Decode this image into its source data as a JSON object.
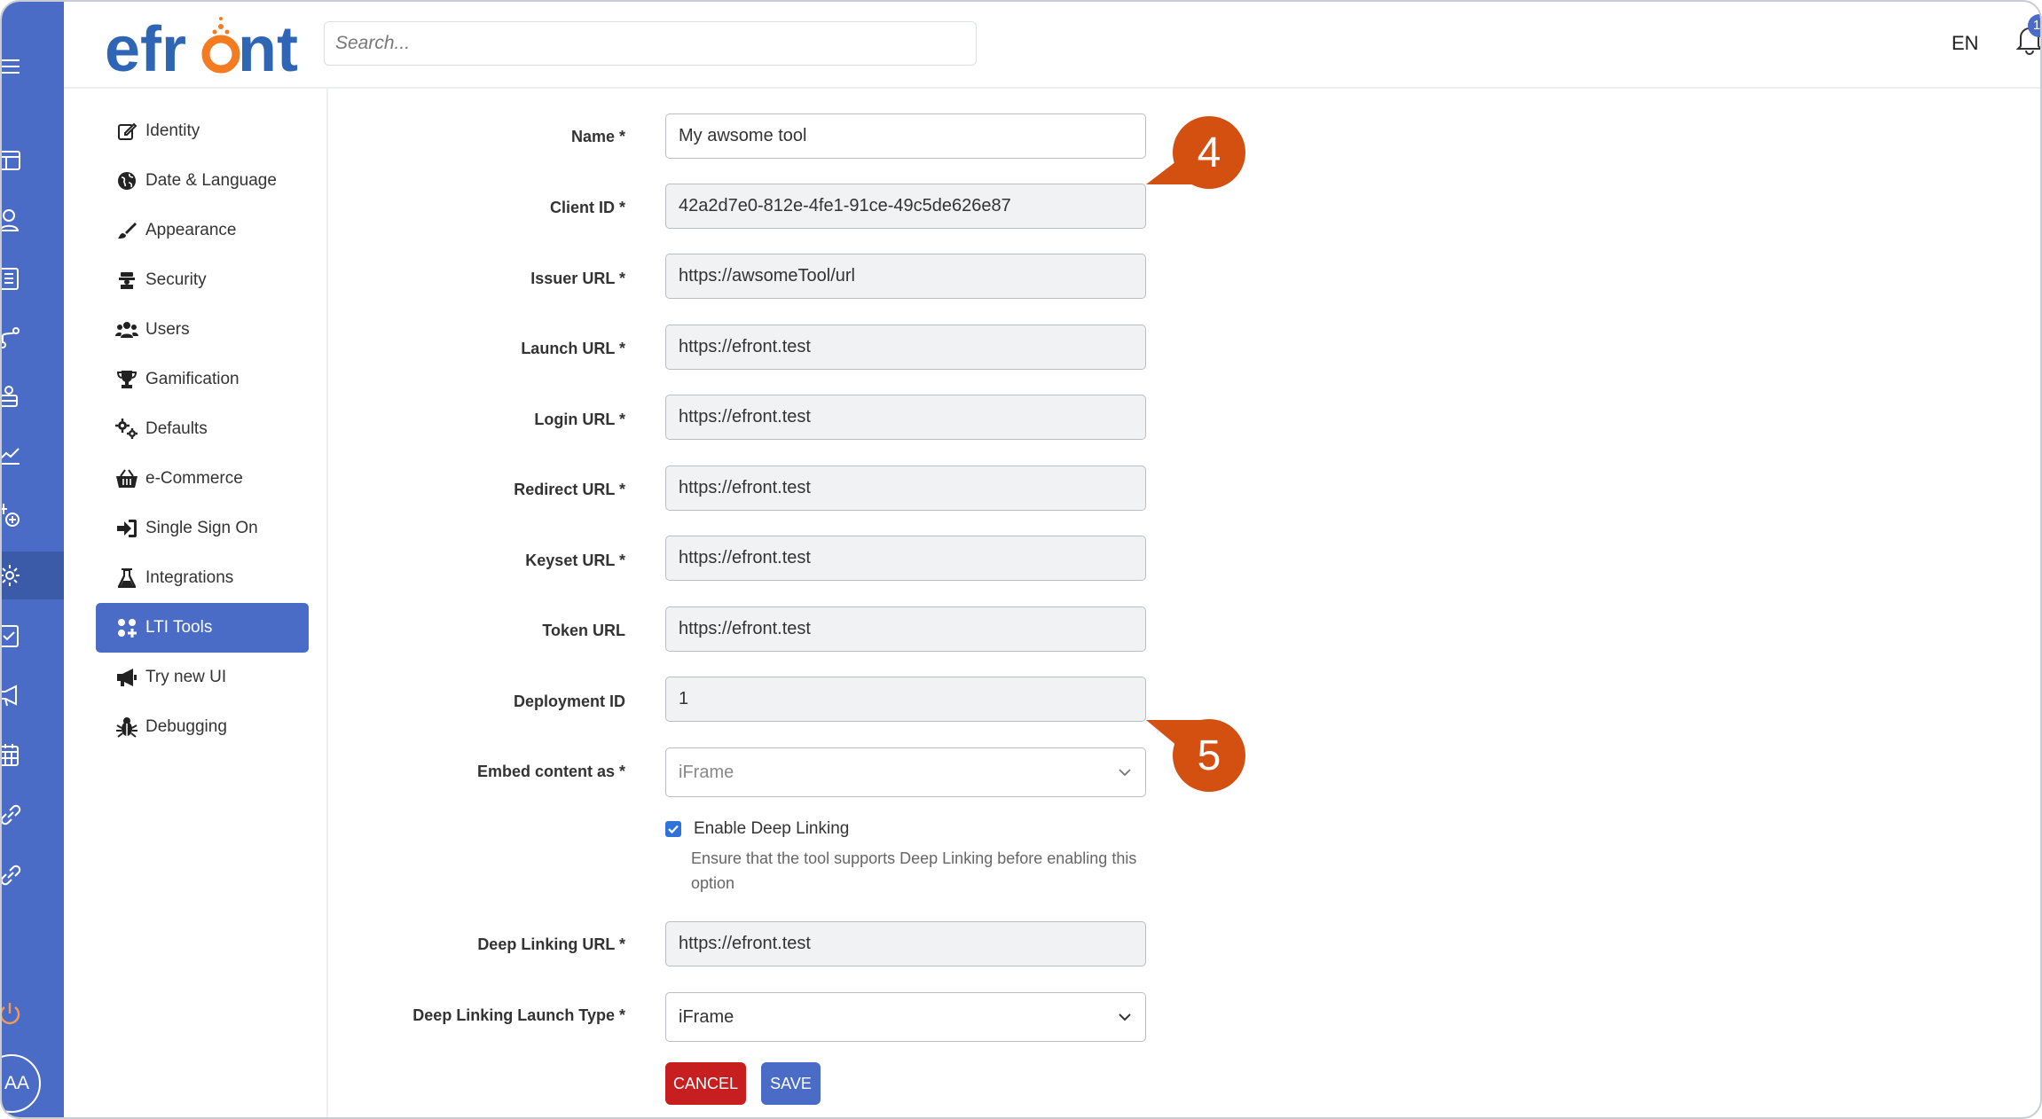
{
  "header": {
    "logo": "efront",
    "search_placeholder": "Search...",
    "language": "EN",
    "notification_count": "1"
  },
  "rail": {
    "avatar": "AA",
    "icons": [
      "menu-icon",
      "layout-icon",
      "user-icon",
      "book-icon",
      "branch-icon",
      "group-icon",
      "chart-icon",
      "add-node-icon",
      "gear-icon",
      "checklist-icon",
      "megaphone-icon",
      "calendar-icon",
      "link-icon",
      "link-icon",
      "power-icon"
    ]
  },
  "subnav": {
    "items": [
      {
        "label": "Identity",
        "icon": "edit-icon"
      },
      {
        "label": "Date & Language",
        "icon": "globe-icon"
      },
      {
        "label": "Appearance",
        "icon": "brush-icon"
      },
      {
        "label": "Security",
        "icon": "security-icon"
      },
      {
        "label": "Users",
        "icon": "users-icon"
      },
      {
        "label": "Gamification",
        "icon": "trophy-icon"
      },
      {
        "label": "Defaults",
        "icon": "cogs-icon"
      },
      {
        "label": "e-Commerce",
        "icon": "basket-icon"
      },
      {
        "label": "Single Sign On",
        "icon": "sign-in-icon"
      },
      {
        "label": "Integrations",
        "icon": "flask-icon"
      },
      {
        "label": "LTI Tools",
        "icon": "grid-plus-icon",
        "active": true
      },
      {
        "label": "Try new UI",
        "icon": "bullhorn-icon"
      },
      {
        "label": "Debugging",
        "icon": "bug-icon"
      }
    ]
  },
  "form": {
    "name": {
      "label": "Name *",
      "value": "My awsome tool"
    },
    "client_id": {
      "label": "Client ID *",
      "value": "42a2d7e0-812e-4fe1-91ce-49c5de626e87"
    },
    "issuer_url": {
      "label": "Issuer URL *",
      "value": "https://awsomeTool/url"
    },
    "launch_url": {
      "label": "Launch URL *",
      "value": "https://efront.test"
    },
    "login_url": {
      "label": "Login URL *",
      "value": "https://efront.test"
    },
    "redirect_url": {
      "label": "Redirect URL *",
      "value": "https://efront.test"
    },
    "keyset_url": {
      "label": "Keyset URL *",
      "value": "https://efront.test"
    },
    "token_url": {
      "label": "Token URL",
      "value": "https://efront.test"
    },
    "deployment_id": {
      "label": "Deployment ID",
      "value": "1"
    },
    "embed_content": {
      "label": "Embed content as *",
      "value": "iFrame"
    },
    "deep_linking": {
      "checkbox_label": "Enable Deep Linking",
      "checked": true,
      "hint": "Ensure that the tool supports Deep Linking before enabling this option"
    },
    "deep_linking_url": {
      "label": "Deep Linking URL *",
      "value": "https://efront.test"
    },
    "deep_linking_launch_type": {
      "label": "Deep Linking Launch Type *",
      "value": "iFrame"
    },
    "cancel_label": "CANCEL",
    "save_label": "SAVE"
  },
  "callouts": [
    "4",
    "5"
  ],
  "colors": {
    "primary": "#4a6cc6",
    "cancel": "#c71f1f",
    "callout": "#d35011",
    "logo_blue": "#2e66b5",
    "logo_orange": "#f47b20"
  }
}
